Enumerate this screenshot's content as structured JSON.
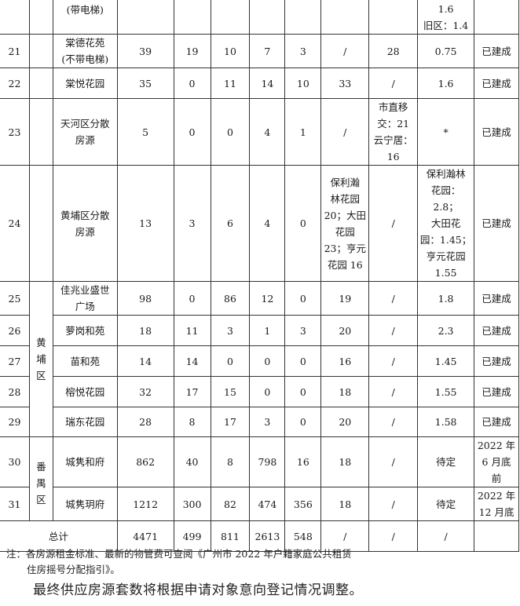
{
  "top_row": {
    "name": "(带电梯)",
    "rent": "1.6\n旧区：1.4"
  },
  "rows": [
    {
      "no": "21",
      "name": "棠德花苑\n(不带电梯)",
      "total": "39",
      "c1": "19",
      "c2": "10",
      "c3": "7",
      "c4": "3",
      "c5": "/",
      "c6": "28",
      "rent": "0.75",
      "status": "已建成"
    },
    {
      "no": "22",
      "name": "棠悦花园",
      "total": "35",
      "c1": "0",
      "c2": "11",
      "c3": "14",
      "c4": "10",
      "c5": "33",
      "c6": "/",
      "rent": "1.6",
      "status": "已建成"
    },
    {
      "no": "23",
      "name": "天河区分散\n房源",
      "total": "5",
      "c1": "0",
      "c2": "0",
      "c3": "4",
      "c4": "1",
      "c5": "/",
      "c6": "市直移\n交：21\n云宁居：\n16",
      "rent": "*",
      "status": "已建成"
    },
    {
      "no": "24",
      "name": "黄埔区分散\n房源",
      "total": "13",
      "c1": "3",
      "c2": "6",
      "c3": "4",
      "c4": "0",
      "c5": "保利瀚\n林花园\n20；大田\n花园\n23；亨元\n花园 16",
      "c6": "/",
      "rent": "保利瀚林\n花园：2.8；\n大田花\n园：1.45；\n亨元花园\n1.55",
      "status": "已建成"
    },
    {
      "no": "25",
      "name": "佳兆业盛世\n广场",
      "total": "98",
      "c1": "0",
      "c2": "86",
      "c3": "12",
      "c4": "0",
      "c5": "19",
      "c6": "/",
      "rent": "1.8",
      "status": "已建成"
    },
    {
      "no": "26",
      "name": "萝岗和苑",
      "total": "18",
      "c1": "11",
      "c2": "3",
      "c3": "1",
      "c4": "3",
      "c5": "20",
      "c6": "/",
      "rent": "2.3",
      "status": "已建成"
    },
    {
      "no": "27",
      "name": "苗和苑",
      "total": "14",
      "c1": "14",
      "c2": "0",
      "c3": "0",
      "c4": "0",
      "c5": "16",
      "c6": "/",
      "rent": "1.45",
      "status": "已建成"
    },
    {
      "no": "28",
      "name": "榕悦花园",
      "total": "32",
      "c1": "17",
      "c2": "15",
      "c3": "0",
      "c4": "0",
      "c5": "18",
      "c6": "/",
      "rent": "1.55",
      "status": "已建成"
    },
    {
      "no": "29",
      "name": "瑞东花园",
      "total": "28",
      "c1": "8",
      "c2": "17",
      "c3": "3",
      "c4": "0",
      "c5": "20",
      "c6": "/",
      "rent": "1.58",
      "status": "已建成"
    },
    {
      "no": "30",
      "name": "城隽和府",
      "total": "862",
      "c1": "40",
      "c2": "8",
      "c3": "798",
      "c4": "16",
      "c5": "18",
      "c6": "/",
      "rent": "待定",
      "status": "2022 年\n6 月底\n前"
    },
    {
      "no": "31",
      "name": "城隽玥府",
      "total": "1212",
      "c1": "300",
      "c2": "82",
      "c3": "474",
      "c4": "356",
      "c5": "18",
      "c6": "/",
      "rent": "待定",
      "status": "2022 年\n12 月底"
    }
  ],
  "districts": {
    "huangpu": "黄\n埔\n区",
    "panyu": "番\n禺\n区"
  },
  "total_row": {
    "label": "总计",
    "total": "4471",
    "c1": "499",
    "c2": "811",
    "c3": "2613",
    "c4": "548",
    "c5": "/",
    "c6": "/",
    "rent": "/",
    "status": ""
  },
  "note": {
    "line1": "注：各房源租金标准、最新的物管费可查阅《广州市 2022 年户籍家庭公共租赁",
    "line2": "住房摇号分配指引》。"
  },
  "final_text": "最终供应房源套数将根据申请对象意向登记情况调整。"
}
